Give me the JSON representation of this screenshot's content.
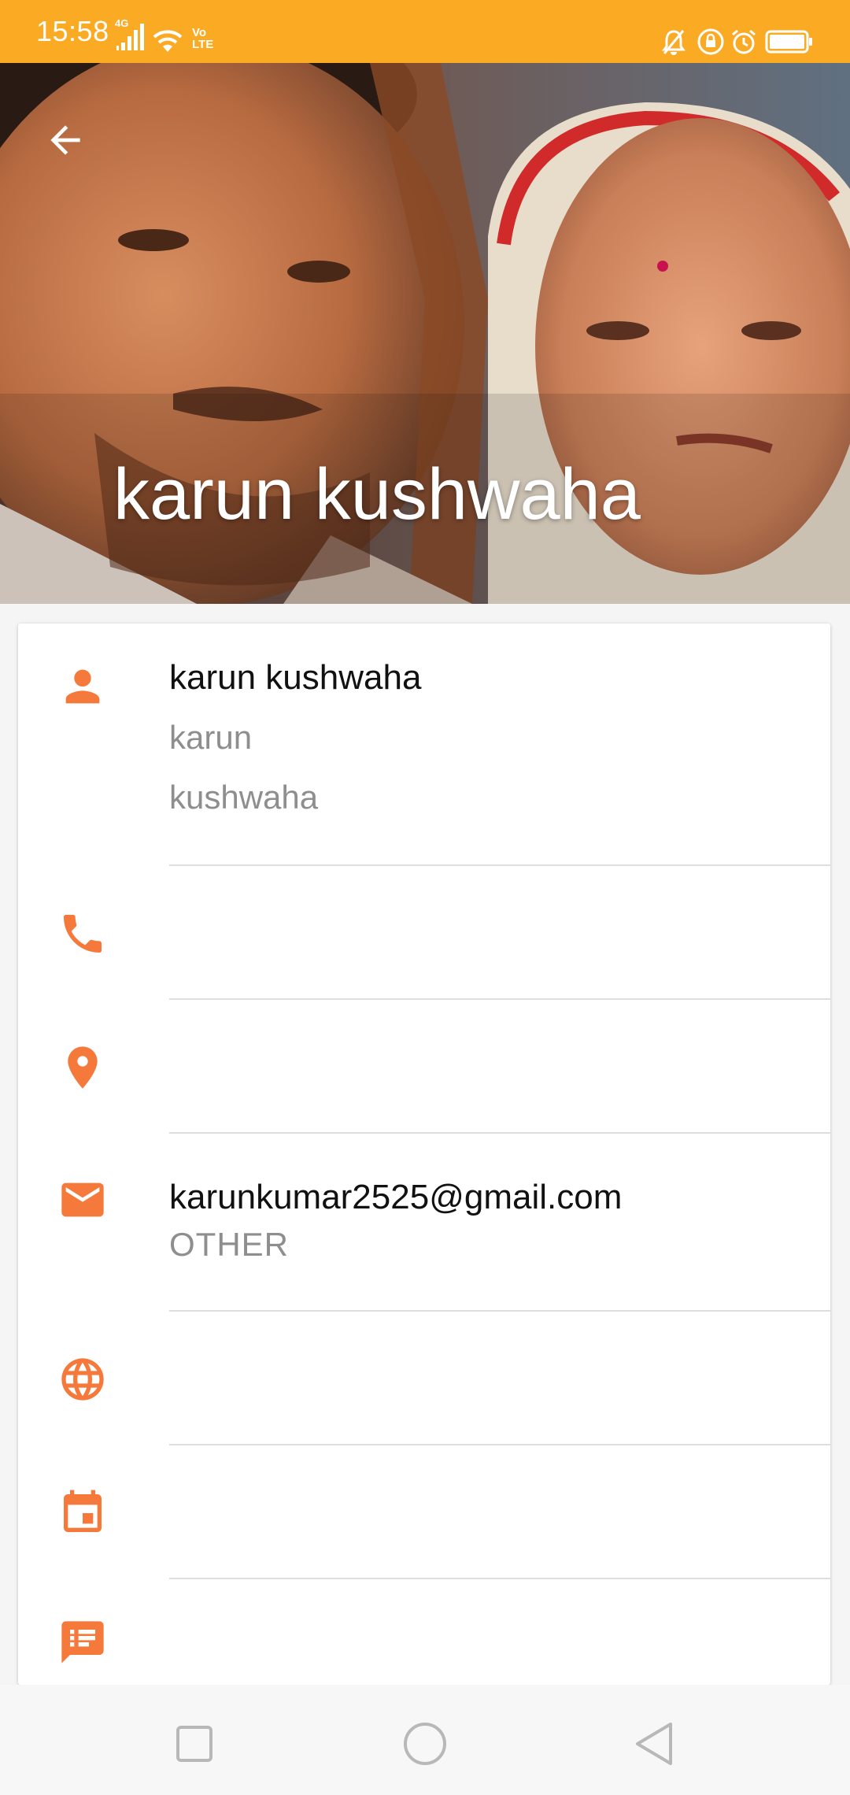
{
  "status_bar": {
    "time": "15:58",
    "network_label": "4G",
    "volte_label": "Vo LTE",
    "icons": [
      "signal-icon",
      "wifi-icon",
      "volte-icon",
      "mute-icon",
      "lock-icon",
      "alarm-icon",
      "battery-icon"
    ],
    "background_color": "#fbaa23"
  },
  "header": {
    "title": "karun kushwaha",
    "back_icon": "arrow-back-icon"
  },
  "contact": {
    "name": {
      "display_name": "karun kushwaha",
      "first_name": "karun",
      "last_name": "kushwaha",
      "icon": "person-icon"
    },
    "phone": {
      "value": "",
      "icon": "phone-icon"
    },
    "address": {
      "value": "",
      "icon": "location-pin-icon"
    },
    "email": {
      "value": "karunkumar2525@gmail.com",
      "type": "OTHER",
      "icon": "email-icon"
    },
    "website": {
      "value": "",
      "icon": "globe-icon"
    },
    "event": {
      "value": "",
      "icon": "calendar-icon"
    },
    "notes": {
      "value": "",
      "icon": "notes-icon"
    }
  },
  "colors": {
    "accent": "#f5793b",
    "primary_text": "#111111",
    "secondary_text": "#8e8e8e"
  },
  "nav_bar": {
    "buttons": [
      "recents-button",
      "home-button",
      "back-button"
    ]
  }
}
